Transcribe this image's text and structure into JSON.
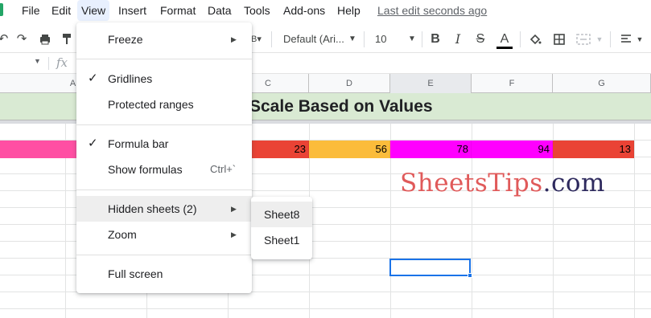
{
  "menubar": {
    "items": [
      "File",
      "Edit",
      "View",
      "Insert",
      "Format",
      "Data",
      "Tools",
      "Add-ons",
      "Help"
    ],
    "active_item": "View",
    "last_edit": "Last edit seconds ago"
  },
  "toolbar": {
    "font_name": "Default (Ari...",
    "font_size": "10",
    "text_color": "#000000"
  },
  "formula_bar": {
    "fx_label": "fx",
    "cell_value": ""
  },
  "columns": [
    "A",
    "C",
    "D",
    "E",
    "F",
    "G"
  ],
  "selected_column": "E",
  "sheet": {
    "title": "Scale Based on Values",
    "data_row": {
      "C": "23",
      "D": "56",
      "E": "78",
      "F": "94",
      "G": "13"
    },
    "cell_colors": {
      "A": "#ff4fa3",
      "C": "#ea4335",
      "D": "#fbbc3b",
      "E": "#ff00ff",
      "F": "#ff00ff",
      "G": "#ea4335"
    },
    "title_band_color": "#d9ead3"
  },
  "view_menu": {
    "items": [
      {
        "label": "Freeze",
        "checked": false,
        "submenu": true,
        "shortcut": ""
      },
      {
        "label": "Gridlines",
        "checked": true,
        "submenu": false,
        "shortcut": ""
      },
      {
        "label": "Protected ranges",
        "checked": false,
        "submenu": false,
        "shortcut": ""
      },
      {
        "label": "Formula bar",
        "checked": true,
        "submenu": false,
        "shortcut": ""
      },
      {
        "label": "Show formulas",
        "checked": false,
        "submenu": false,
        "shortcut": "Ctrl+`"
      },
      {
        "label": "Hidden sheets (2)",
        "checked": false,
        "submenu": true,
        "shortcut": "",
        "highlighted": true
      },
      {
        "label": "Zoom",
        "checked": false,
        "submenu": true,
        "shortcut": ""
      },
      {
        "label": "Full screen",
        "checked": false,
        "submenu": false,
        "shortcut": ""
      }
    ],
    "check_glyph": "✓",
    "arrow_glyph": "▶"
  },
  "hidden_sheets_submenu": {
    "items": [
      "Sheet8",
      "Sheet1"
    ]
  },
  "watermark": {
    "part_a": "Sheets",
    "part_b": "Tips",
    "part_c": ".com"
  }
}
